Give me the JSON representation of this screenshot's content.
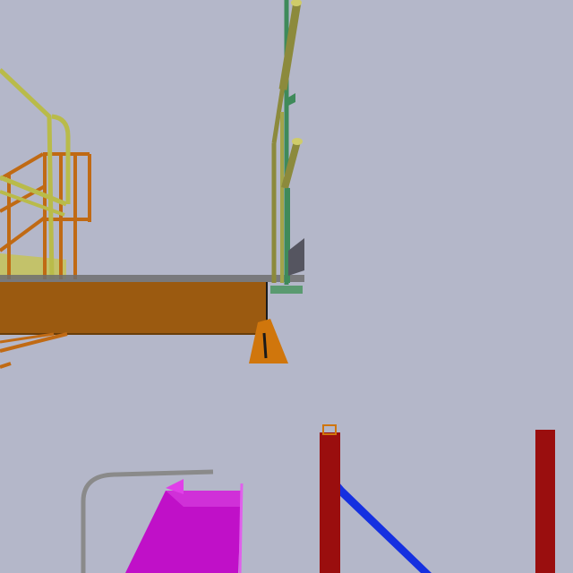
{
  "scene": {
    "background_color": "#b4b7c9",
    "colors": {
      "deck_orange": "#9b5a10",
      "deck_top": "#6f6f6f",
      "railing_orange": "#c06a14",
      "railing_yellow": "#b9bb4a",
      "pole_olive": "#8c8a3c",
      "pole_green": "#3f8a5a",
      "plinth_orange": "#d0760c",
      "chute_magenta": "#c010c8",
      "pipe_gray": "#8a8a8a",
      "post_red": "#9a0e0e",
      "brace_blue": "#1530e0",
      "panel_dark": "#555560"
    },
    "objects": [
      "deck-beam",
      "stair-railing",
      "handrail",
      "light-poles",
      "plinth",
      "chute",
      "bent-pipe",
      "red-posts",
      "blue-brace"
    ]
  }
}
